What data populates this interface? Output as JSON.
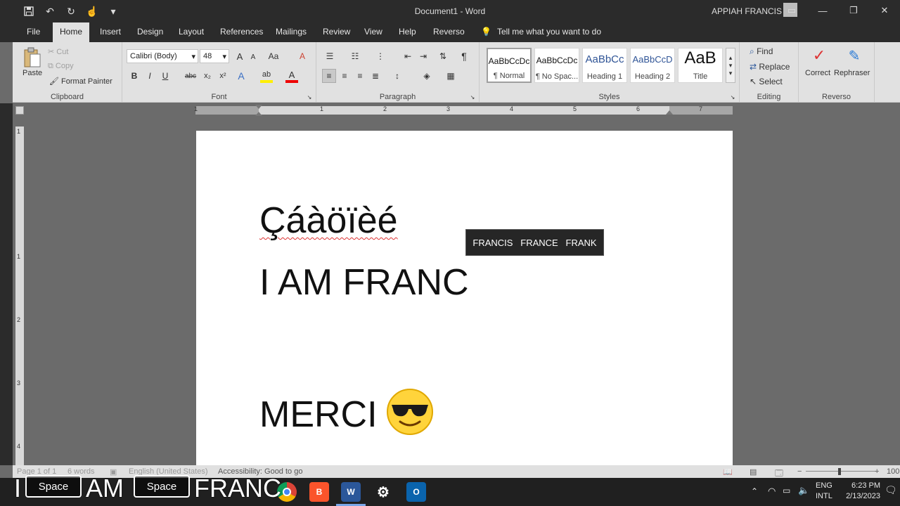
{
  "window": {
    "title": "Document1  -  Word",
    "user": "APPIAH FRANCIS",
    "controls": [
      "minimize",
      "restore",
      "close"
    ]
  },
  "quick_access": {
    "icons": [
      "save-icon",
      "undo-icon",
      "redo-icon",
      "touch-mode-icon",
      "customize-icon"
    ]
  },
  "tabs": [
    {
      "label": "File"
    },
    {
      "label": "Home",
      "active": true
    },
    {
      "label": "Insert"
    },
    {
      "label": "Design"
    },
    {
      "label": "Layout"
    },
    {
      "label": "References"
    },
    {
      "label": "Mailings"
    },
    {
      "label": "Review"
    },
    {
      "label": "View"
    },
    {
      "label": "Help"
    },
    {
      "label": "Reverso"
    }
  ],
  "tell_me": "Tell me what you want to do",
  "ribbon": {
    "clipboard": {
      "paste": "Paste",
      "cut": "Cut",
      "copy": "Copy",
      "format_painter": "Format Painter",
      "label": "Clipboard"
    },
    "font": {
      "font_name": "Calibri (Body)",
      "font_size": "48",
      "label": "Font",
      "grow_glyph": "A",
      "shrink_glyph": "A",
      "case_glyph": "Aa",
      "clear_glyph": "A",
      "bold_glyph": "B",
      "italic_glyph": "I",
      "underline_glyph": "U",
      "strike_glyph": "abc",
      "subscript_glyph": "x₂",
      "superscript_glyph": "x²",
      "effects_glyph": "A",
      "highlight_glyph": "ab",
      "color_glyph": "A"
    },
    "paragraph": {
      "label": "Paragraph",
      "pilcrow": "¶"
    },
    "styles": {
      "label": "Styles",
      "items": [
        {
          "preview": "AaBbCcDc",
          "name": "¶ Normal",
          "selected": true
        },
        {
          "preview": "AaBbCcDc",
          "name": "¶ No Spac..."
        },
        {
          "preview": "AaBbCc",
          "name": "Heading 1"
        },
        {
          "preview": "AaBbCcD",
          "name": "Heading 2"
        },
        {
          "preview": "AaB",
          "name": "Title"
        }
      ]
    },
    "editing": {
      "find": "Find",
      "replace": "Replace",
      "select": "Select",
      "label": "Editing"
    },
    "reverso": {
      "correct": "Correct",
      "rephraser": "Rephraser",
      "label": "Reverso"
    }
  },
  "ruler": {
    "h_numbers": [
      "1",
      "1",
      "2",
      "3",
      "4",
      "5",
      "6",
      "7"
    ],
    "v_numbers": [
      "1",
      "1",
      "2",
      "3",
      "4"
    ]
  },
  "document": {
    "line1": "Çáàöïèé",
    "line2": "I AM FRANC",
    "line3": "MERCI",
    "emoji": "smiling-face-with-sunglasses"
  },
  "suggestions": [
    "FRANCIS",
    "FRANCE",
    "FRANK"
  ],
  "status": {
    "page": "Page 1 of 1",
    "words": "6 words",
    "language": "English (United States)",
    "accessibility": "Accessibility: Good to go",
    "zoom": "100"
  },
  "overlay": {
    "text1": "I",
    "key1": "Space",
    "text2": "AM",
    "key2": "Space",
    "text3": "FRANC"
  },
  "taskbar": {
    "apps": [
      "chrome",
      "brave",
      "word",
      "settings",
      "outlook"
    ],
    "word_glyph": "W",
    "outlook_glyph": "O",
    "brave_glyph": "B",
    "lang1": "ENG",
    "lang2": "INTL",
    "time": "6:23 PM",
    "date": "2/13/2023"
  },
  "colors": {
    "accent_dark": "#2b2b2b",
    "ribbon": "#e1e1e1",
    "word_blue": "#2b579a",
    "red_squiggle": "#d33"
  }
}
